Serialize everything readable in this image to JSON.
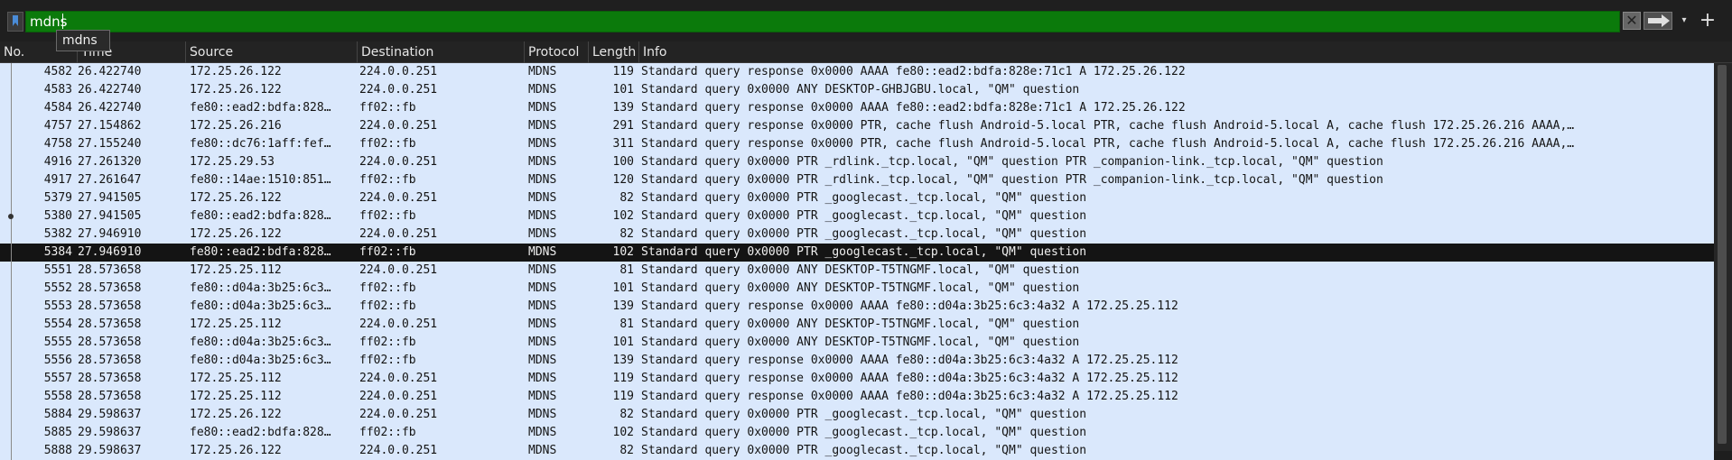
{
  "filter": {
    "value": "mdns",
    "autocomplete_suggestion": "mdns",
    "clear_label": "✕",
    "add_label": "+",
    "dropdown_label": "▾"
  },
  "columns": [
    "No.",
    "Time",
    "Source",
    "Destination",
    "Protocol",
    "Length",
    "Info"
  ],
  "rows": [
    {
      "no": "4582",
      "time": "26.422740",
      "src": "172.25.26.122",
      "dst": "224.0.0.251",
      "proto": "MDNS",
      "len": "119",
      "info": "Standard query response 0x0000 AAAA fe80::ead2:bdfa:828e:71c1 A 172.25.26.122"
    },
    {
      "no": "4583",
      "time": "26.422740",
      "src": "172.25.26.122",
      "dst": "224.0.0.251",
      "proto": "MDNS",
      "len": "101",
      "info": "Standard query 0x0000 ANY DESKTOP-GHBJGBU.local, \"QM\" question"
    },
    {
      "no": "4584",
      "time": "26.422740",
      "src": "fe80::ead2:bdfa:828…",
      "dst": "ff02::fb",
      "proto": "MDNS",
      "len": "139",
      "info": "Standard query response 0x0000 AAAA fe80::ead2:bdfa:828e:71c1 A 172.25.26.122"
    },
    {
      "no": "4757",
      "time": "27.154862",
      "src": "172.25.26.216",
      "dst": "224.0.0.251",
      "proto": "MDNS",
      "len": "291",
      "info": "Standard query response 0x0000 PTR, cache flush Android-5.local PTR, cache flush Android-5.local A, cache flush 172.25.26.216 AAAA,…"
    },
    {
      "no": "4758",
      "time": "27.155240",
      "src": "fe80::dc76:1aff:fef…",
      "dst": "ff02::fb",
      "proto": "MDNS",
      "len": "311",
      "info": "Standard query response 0x0000 PTR, cache flush Android-5.local PTR, cache flush Android-5.local A, cache flush 172.25.26.216 AAAA,…"
    },
    {
      "no": "4916",
      "time": "27.261320",
      "src": "172.25.29.53",
      "dst": "224.0.0.251",
      "proto": "MDNS",
      "len": "100",
      "info": "Standard query 0x0000 PTR _rdlink._tcp.local, \"QM\" question PTR _companion-link._tcp.local, \"QM\" question"
    },
    {
      "no": "4917",
      "time": "27.261647",
      "src": "fe80::14ae:1510:851…",
      "dst": "ff02::fb",
      "proto": "MDNS",
      "len": "120",
      "info": "Standard query 0x0000 PTR _rdlink._tcp.local, \"QM\" question PTR _companion-link._tcp.local, \"QM\" question"
    },
    {
      "no": "5379",
      "time": "27.941505",
      "src": "172.25.26.122",
      "dst": "224.0.0.251",
      "proto": "MDNS",
      "len": "82",
      "info": "Standard query 0x0000 PTR _googlecast._tcp.local, \"QM\" question"
    },
    {
      "no": "5380",
      "time": "27.941505",
      "src": "fe80::ead2:bdfa:828…",
      "dst": "ff02::fb",
      "proto": "MDNS",
      "len": "102",
      "info": "Standard query 0x0000 PTR _googlecast._tcp.local, \"QM\" question"
    },
    {
      "no": "5382",
      "time": "27.946910",
      "src": "172.25.26.122",
      "dst": "224.0.0.251",
      "proto": "MDNS",
      "len": "82",
      "info": "Standard query 0x0000 PTR _googlecast._tcp.local, \"QM\" question"
    },
    {
      "no": "5384",
      "time": "27.946910",
      "src": "fe80::ead2:bdfa:828…",
      "dst": "ff02::fb",
      "proto": "MDNS",
      "len": "102",
      "info": "Standard query 0x0000 PTR _googlecast._tcp.local, \"QM\" question"
    },
    {
      "no": "5551",
      "time": "28.573658",
      "src": "172.25.25.112",
      "dst": "224.0.0.251",
      "proto": "MDNS",
      "len": "81",
      "info": "Standard query 0x0000 ANY DESKTOP-T5TNGMF.local, \"QM\" question"
    },
    {
      "no": "5552",
      "time": "28.573658",
      "src": "fe80::d04a:3b25:6c3…",
      "dst": "ff02::fb",
      "proto": "MDNS",
      "len": "101",
      "info": "Standard query 0x0000 ANY DESKTOP-T5TNGMF.local, \"QM\" question"
    },
    {
      "no": "5553",
      "time": "28.573658",
      "src": "fe80::d04a:3b25:6c3…",
      "dst": "ff02::fb",
      "proto": "MDNS",
      "len": "139",
      "info": "Standard query response 0x0000 AAAA fe80::d04a:3b25:6c3:4a32 A 172.25.25.112"
    },
    {
      "no": "5554",
      "time": "28.573658",
      "src": "172.25.25.112",
      "dst": "224.0.0.251",
      "proto": "MDNS",
      "len": "81",
      "info": "Standard query 0x0000 ANY DESKTOP-T5TNGMF.local, \"QM\" question"
    },
    {
      "no": "5555",
      "time": "28.573658",
      "src": "fe80::d04a:3b25:6c3…",
      "dst": "ff02::fb",
      "proto": "MDNS",
      "len": "101",
      "info": "Standard query 0x0000 ANY DESKTOP-T5TNGMF.local, \"QM\" question"
    },
    {
      "no": "5556",
      "time": "28.573658",
      "src": "fe80::d04a:3b25:6c3…",
      "dst": "ff02::fb",
      "proto": "MDNS",
      "len": "139",
      "info": "Standard query response 0x0000 AAAA fe80::d04a:3b25:6c3:4a32 A 172.25.25.112"
    },
    {
      "no": "5557",
      "time": "28.573658",
      "src": "172.25.25.112",
      "dst": "224.0.0.251",
      "proto": "MDNS",
      "len": "119",
      "info": "Standard query response 0x0000 AAAA fe80::d04a:3b25:6c3:4a32 A 172.25.25.112"
    },
    {
      "no": "5558",
      "time": "28.573658",
      "src": "172.25.25.112",
      "dst": "224.0.0.251",
      "proto": "MDNS",
      "len": "119",
      "info": "Standard query response 0x0000 AAAA fe80::d04a:3b25:6c3:4a32 A 172.25.25.112"
    },
    {
      "no": "5884",
      "time": "29.598637",
      "src": "172.25.26.122",
      "dst": "224.0.0.251",
      "proto": "MDNS",
      "len": "82",
      "info": "Standard query 0x0000 PTR _googlecast._tcp.local, \"QM\" question"
    },
    {
      "no": "5885",
      "time": "29.598637",
      "src": "fe80::ead2:bdfa:828…",
      "dst": "ff02::fb",
      "proto": "MDNS",
      "len": "102",
      "info": "Standard query 0x0000 PTR _googlecast._tcp.local, \"QM\" question"
    },
    {
      "no": "5888",
      "time": "29.598637",
      "src": "172.25.26.122",
      "dst": "224.0.0.251",
      "proto": "MDNS",
      "len": "82",
      "info": "Standard query 0x0000 PTR _googlecast._tcp.local, \"QM\" question"
    }
  ],
  "selected_row_index": 10,
  "related_row_index": 8,
  "colors": {
    "filter_valid_bg": "#0b7a0b",
    "row_bg": "#dae8fc",
    "selected_bg": "#141414"
  }
}
